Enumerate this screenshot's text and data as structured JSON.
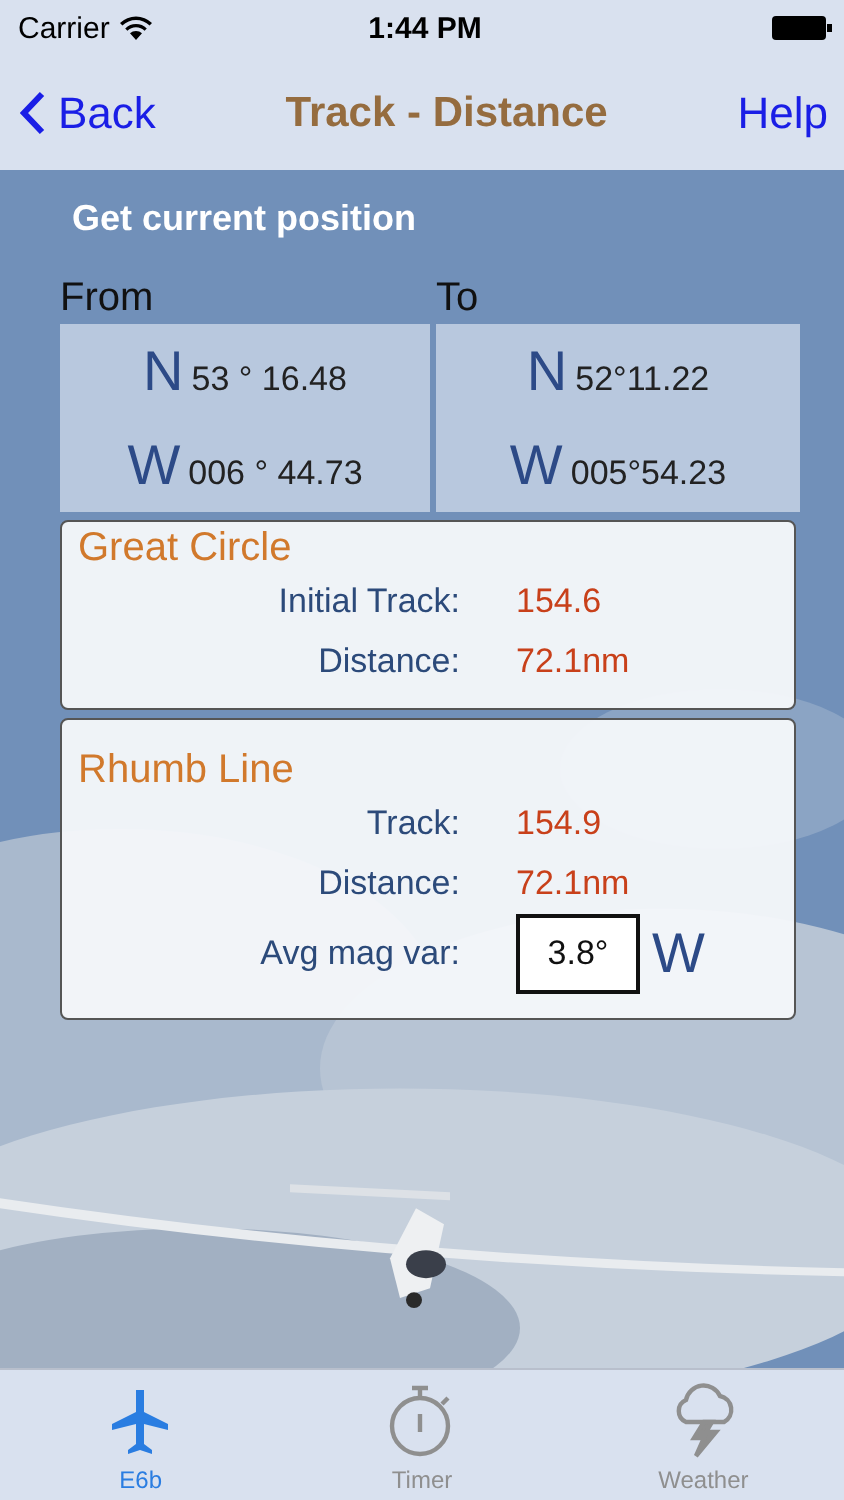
{
  "status_bar": {
    "carrier": "Carrier",
    "time": "1:44 PM"
  },
  "nav": {
    "back": "Back",
    "title": "Track - Distance",
    "help": "Help"
  },
  "get_position": "Get current position",
  "points": [
    {
      "label": "From",
      "lat": {
        "hemisphere": "N",
        "value": "53 ° 16.48"
      },
      "lon": {
        "hemisphere": "W",
        "value": "006 ° 44.73"
      }
    },
    {
      "label": "To",
      "lat": {
        "hemisphere": "N",
        "value": "52°11.22"
      },
      "lon": {
        "hemisphere": "W",
        "value": "005°54.23"
      }
    }
  ],
  "great_circle": {
    "title": "Great Circle",
    "rows": [
      {
        "label": "Initial Track:",
        "value": "154.6"
      },
      {
        "label": "Distance:",
        "value": "72.1nm"
      }
    ]
  },
  "rhumb_line": {
    "title": "Rhumb Line",
    "rows": [
      {
        "label": "Track:",
        "value": "154.9"
      },
      {
        "label": "Distance:",
        "value": "72.1nm"
      }
    ],
    "mag_var": {
      "label": "Avg mag var:",
      "value": "3.8°",
      "direction": "W"
    }
  },
  "tabs": [
    {
      "label": "E6b",
      "kind": "plane",
      "selected": true
    },
    {
      "label": "Timer",
      "kind": "stopwatch",
      "selected": false
    },
    {
      "label": "Weather",
      "kind": "storm",
      "selected": false
    }
  ]
}
